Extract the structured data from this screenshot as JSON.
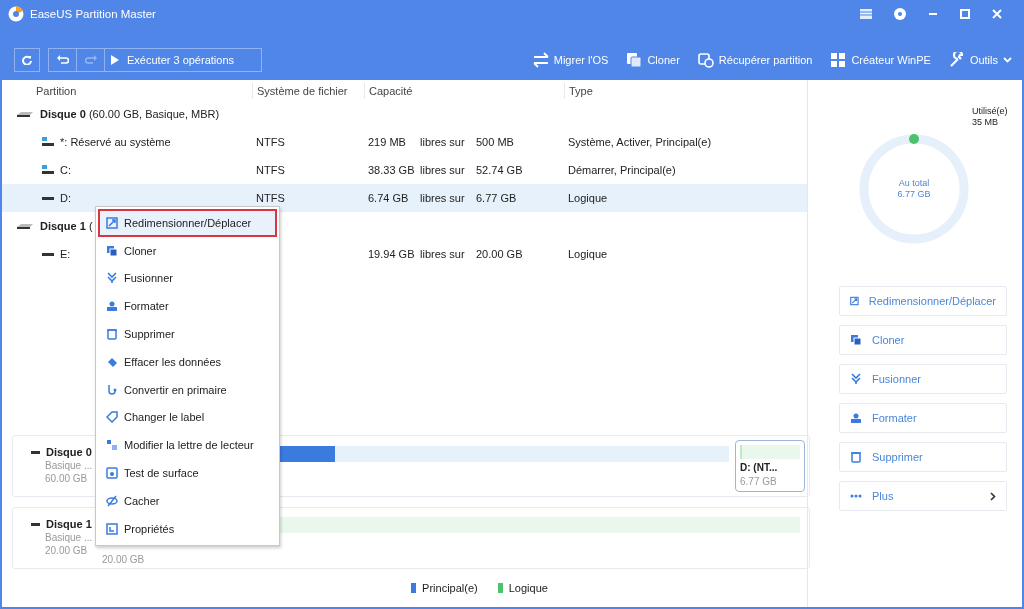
{
  "window": {
    "title": "EaseUS Partition Master"
  },
  "toolbar": {
    "execute": "Exécuter 3 opérations",
    "undo_disabled": false,
    "redo_disabled": true,
    "tools": [
      {
        "label": "Migrer l'OS",
        "kind": "migrate"
      },
      {
        "label": "Cloner",
        "kind": "clone"
      },
      {
        "label": "Récupérer partition",
        "kind": "recover"
      },
      {
        "label": "Créateur WinPE",
        "kind": "winpe"
      },
      {
        "label": "Outils",
        "kind": "tools"
      }
    ]
  },
  "table": {
    "columns": [
      "Partition",
      "Système de fichier",
      "Capacité",
      "Type"
    ],
    "rows": [
      {
        "kind": "disk",
        "name": "Disque 0",
        "detail": "(60.00 GB, Basique, MBR)",
        "selected": false
      },
      {
        "kind": "system",
        "name": "*: Réservé au système",
        "fs": "NTFS",
        "free": "219 MB",
        "of": "libres sur",
        "total": "500 MB",
        "type": "Système, Activer, Principal(e)",
        "selected": false
      },
      {
        "kind": "system",
        "name": "C:",
        "fs": "NTFS",
        "free": "38.33 GB",
        "of": "libres sur",
        "total": "52.74 GB",
        "type": "Démarrer, Principal(e)",
        "selected": false
      },
      {
        "kind": "data",
        "name": "D:",
        "fs": "NTFS",
        "free": "6.74 GB",
        "of": "libres sur",
        "total": "6.77 GB",
        "type": "Logique",
        "selected": true
      },
      {
        "kind": "disk",
        "name": "Disque 1",
        "detail": "(",
        "selected": false
      },
      {
        "kind": "data",
        "name": "E:",
        "free": "19.94 GB",
        "of": "libres sur",
        "total": "20.00 GB",
        "type": "Logique",
        "selected": false
      }
    ]
  },
  "disk_map": [
    {
      "name": "Disque 0",
      "sub": "Basique ...",
      "size": "60.00 GB",
      "segments": [
        {
          "kind": "primary"
        },
        {
          "kind": "logical",
          "label": "D: (NT...",
          "size": "6.77 GB",
          "selected": true
        }
      ]
    },
    {
      "name": "Disque 1",
      "sub": "Basique ...",
      "size": "20.00 GB",
      "segments": [
        {
          "kind": "logical",
          "size": "20.00 GB",
          "selected": false
        }
      ]
    }
  ],
  "legend": [
    {
      "label": "Principal(e)",
      "color": "#3a7be0"
    },
    {
      "label": "Logique",
      "color": "#4cc36a"
    }
  ],
  "context_menu": [
    {
      "label": "Redimensionner/Déplacer",
      "kind": "resize",
      "selected": true
    },
    {
      "label": "Cloner",
      "kind": "clone",
      "selected": false
    },
    {
      "label": "Fusionner",
      "kind": "merge",
      "selected": false
    },
    {
      "label": "Formater",
      "kind": "format",
      "selected": false
    },
    {
      "label": "Supprimer",
      "kind": "delete",
      "selected": false
    },
    {
      "label": "Effacer les données",
      "kind": "wipe",
      "selected": false
    },
    {
      "label": "Convertir en primaire",
      "kind": "convert",
      "selected": false
    },
    {
      "label": "Changer le label",
      "kind": "label",
      "selected": false
    },
    {
      "label": "Modifier la lettre de lecteur",
      "kind": "letter",
      "selected": false
    },
    {
      "label": "Test de surface",
      "kind": "surface",
      "selected": false
    },
    {
      "label": "Cacher",
      "kind": "hide",
      "selected": false
    },
    {
      "label": "Propriétés",
      "kind": "props",
      "selected": false
    }
  ],
  "usage": {
    "used_label": "Utilisé(e)",
    "used": "35 MB",
    "total_label": "Au total",
    "total": "6.77 GB"
  },
  "actions": [
    {
      "label": "Redimensionner/Déplacer",
      "kind": "resize"
    },
    {
      "label": "Cloner",
      "kind": "clone"
    },
    {
      "label": "Fusionner",
      "kind": "merge"
    },
    {
      "label": "Formater",
      "kind": "format"
    },
    {
      "label": "Supprimer",
      "kind": "delete"
    },
    {
      "label": "Plus",
      "kind": "more"
    }
  ]
}
